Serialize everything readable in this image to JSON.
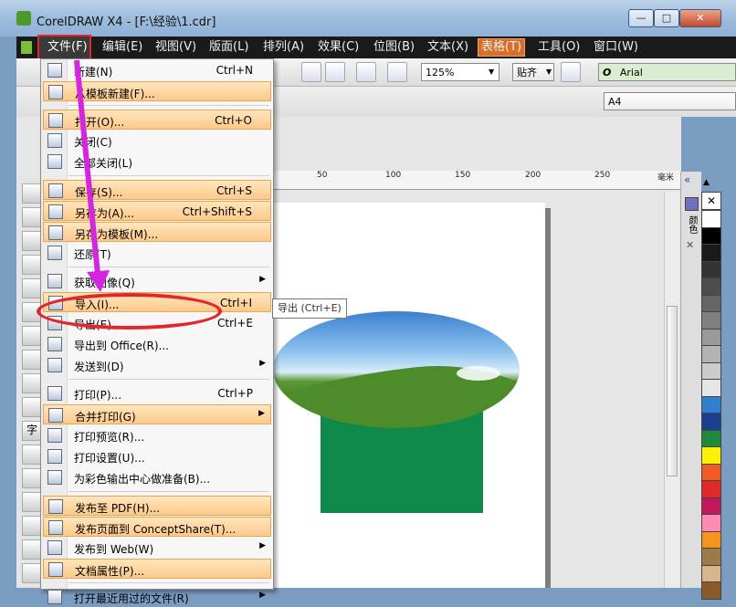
{
  "window": {
    "title": "CorelDRAW X4 - [F:\\经验\\1.cdr]",
    "min": "—",
    "max": "□",
    "close": "✕"
  },
  "menubar": [
    {
      "label": "文件(F)"
    },
    {
      "label": "编辑(E)"
    },
    {
      "label": "视图(V)"
    },
    {
      "label": "版面(L)"
    },
    {
      "label": "排列(A)"
    },
    {
      "label": "效果(C)"
    },
    {
      "label": "位图(B)"
    },
    {
      "label": "文本(X)"
    },
    {
      "label": "表格(T)"
    },
    {
      "label": "工具(O)"
    },
    {
      "label": "窗口(W)"
    }
  ],
  "toolbar": {
    "zoom": "125%",
    "snap": "贴齐",
    "font": "Arial",
    "page_size": "A4"
  },
  "ruler": {
    "ticks": [
      "50",
      "100",
      "150",
      "200",
      "250"
    ],
    "unit": "毫米"
  },
  "file_menu": {
    "items": [
      {
        "label": "新建(N)",
        "shortcut": "Ctrl+N",
        "highlight": false
      },
      {
        "label": "从模板新建(F)...",
        "shortcut": "",
        "highlight": true
      },
      {
        "label": "打开(O)...",
        "shortcut": "Ctrl+O",
        "highlight": true
      },
      {
        "label": "关闭(C)",
        "shortcut": "",
        "highlight": false
      },
      {
        "label": "全部关闭(L)",
        "shortcut": "",
        "highlight": false
      },
      {
        "label": "保存(S)...",
        "shortcut": "Ctrl+S",
        "highlight": true
      },
      {
        "label": "另存为(A)...",
        "shortcut": "Ctrl+Shift+S",
        "highlight": true
      },
      {
        "label": "另存为模板(M)...",
        "shortcut": "",
        "highlight": true
      },
      {
        "label": "还原(T)",
        "shortcut": "",
        "highlight": false
      },
      {
        "label": "获取图像(Q)",
        "shortcut": "",
        "highlight": false,
        "submenu": true
      },
      {
        "label": "导入(I)...",
        "shortcut": "Ctrl+I",
        "highlight": true
      },
      {
        "label": "导出(E)...",
        "shortcut": "Ctrl+E",
        "highlight": false
      },
      {
        "label": "导出到 Office(R)...",
        "shortcut": "",
        "highlight": false
      },
      {
        "label": "发送到(D)",
        "shortcut": "",
        "highlight": false,
        "submenu": true
      },
      {
        "label": "打印(P)...",
        "shortcut": "Ctrl+P",
        "highlight": false
      },
      {
        "label": "合并打印(G)",
        "shortcut": "",
        "highlight": true,
        "submenu": true
      },
      {
        "label": "打印预览(R)...",
        "shortcut": "",
        "highlight": false
      },
      {
        "label": "打印设置(U)...",
        "shortcut": "",
        "highlight": false
      },
      {
        "label": "为彩色输出中心做准备(B)...",
        "shortcut": "",
        "highlight": false
      },
      {
        "label": "发布至 PDF(H)...",
        "shortcut": "",
        "highlight": true
      },
      {
        "label": "发布页面到 ConceptShare(T)...",
        "shortcut": "",
        "highlight": true
      },
      {
        "label": "发布到 Web(W)",
        "shortcut": "",
        "highlight": false,
        "submenu": true
      },
      {
        "label": "文档属性(P)...",
        "shortcut": "",
        "highlight": true
      },
      {
        "label": "打开最近用过的文件(R)",
        "shortcut": "",
        "highlight": false,
        "submenu": true
      }
    ]
  },
  "tooltip": "导出 (Ctrl+E)",
  "palette": {
    "colors": [
      "#ffffff",
      "#000000",
      "#1a1a1a",
      "#333333",
      "#4d4d4d",
      "#666666",
      "#808080",
      "#999999",
      "#b3b3b3",
      "#cccccc",
      "#e6e6e6",
      "#2f7fd2",
      "#1d3f8f",
      "#1f8a3c",
      "#fff200",
      "#f05a23",
      "#e02828",
      "#c2185b",
      "#ff8ab4",
      "#f7941d",
      "#9c7a4a",
      "#d9b58c",
      "#8a5a2b"
    ]
  },
  "palette_panel_label": "颜色"
}
